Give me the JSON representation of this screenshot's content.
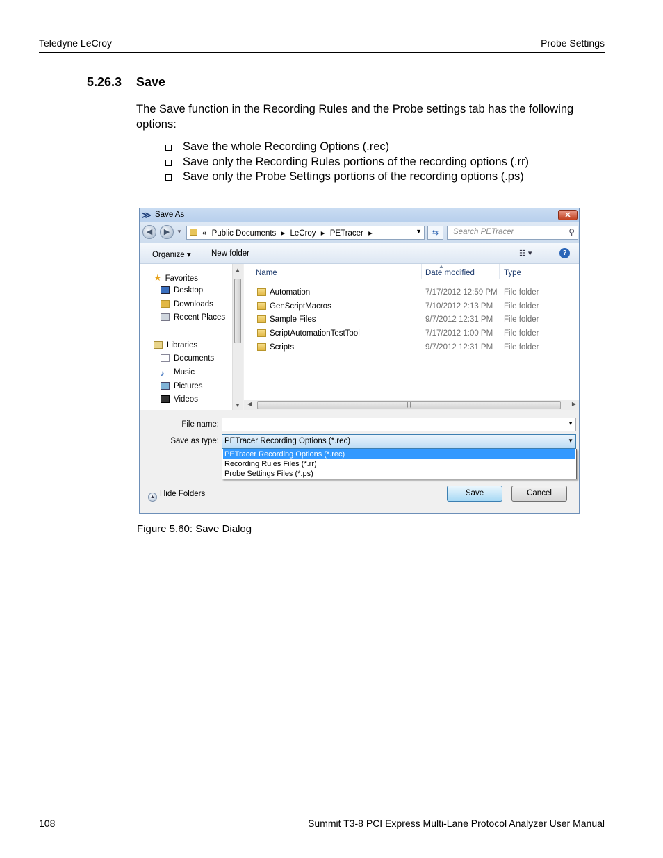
{
  "header": {
    "left": "Teledyne LeCroy",
    "right": "Probe Settings"
  },
  "section": {
    "number": "5.26.3",
    "title": "Save"
  },
  "paragraph": "The Save function in the Recording Rules and the Probe settings tab has the following options:",
  "bullets": [
    "Save the whole Recording Options (.rec)",
    "Save only the Recording Rules portions of the recording options (.rr)",
    "Save only the Probe Settings portions of the recording options (.ps)"
  ],
  "dialog": {
    "title": "Save As",
    "close_glyph": "✕",
    "breadcrumb": [
      "«",
      "Public Documents",
      "▸",
      "LeCroy",
      "▸",
      "PETracer",
      "▸"
    ],
    "search_placeholder": "Search PETracer",
    "toolbar": {
      "organize": "Organize ▾",
      "new_folder": "New folder",
      "views": "☷ ▾",
      "help": "?"
    },
    "nav": {
      "favorites_label": "Favorites",
      "favorites": [
        "Desktop",
        "Downloads",
        "Recent Places"
      ],
      "libraries_label": "Libraries",
      "libraries": [
        "Documents",
        "Music",
        "Pictures",
        "Videos"
      ]
    },
    "columns": {
      "name": "Name",
      "date": "Date modified",
      "type": "Type"
    },
    "files": [
      {
        "name": "Automation",
        "date": "7/17/2012 12:59 PM",
        "type": "File folder"
      },
      {
        "name": "GenScriptMacros",
        "date": "7/10/2012 2:13 PM",
        "type": "File folder"
      },
      {
        "name": "Sample Files",
        "date": "9/7/2012 12:31 PM",
        "type": "File folder"
      },
      {
        "name": "ScriptAutomationTestTool",
        "date": "7/17/2012 1:00 PM",
        "type": "File folder"
      },
      {
        "name": "Scripts",
        "date": "9/7/2012 12:31 PM",
        "type": "File folder"
      }
    ],
    "file_name_label": "File name:",
    "file_name_value": "",
    "save_type_label": "Save as type:",
    "save_type_value": "PETracer Recording Options (*.rec)",
    "type_options": [
      "PETracer Recording Options (*.rec)",
      "Recording Rules Files (*.rr)",
      "Probe Settings Files (*.ps)"
    ],
    "hide_folders": "Hide Folders",
    "save_button": "Save",
    "cancel_button": "Cancel",
    "colors": {
      "selection": "#3399ff",
      "titlebar": "#b7cfec"
    }
  },
  "caption": "Figure 5.60:  Save Dialog",
  "footer": {
    "page": "108",
    "title": "Summit T3-8 PCI Express Multi-Lane Protocol Analyzer User Manual"
  }
}
